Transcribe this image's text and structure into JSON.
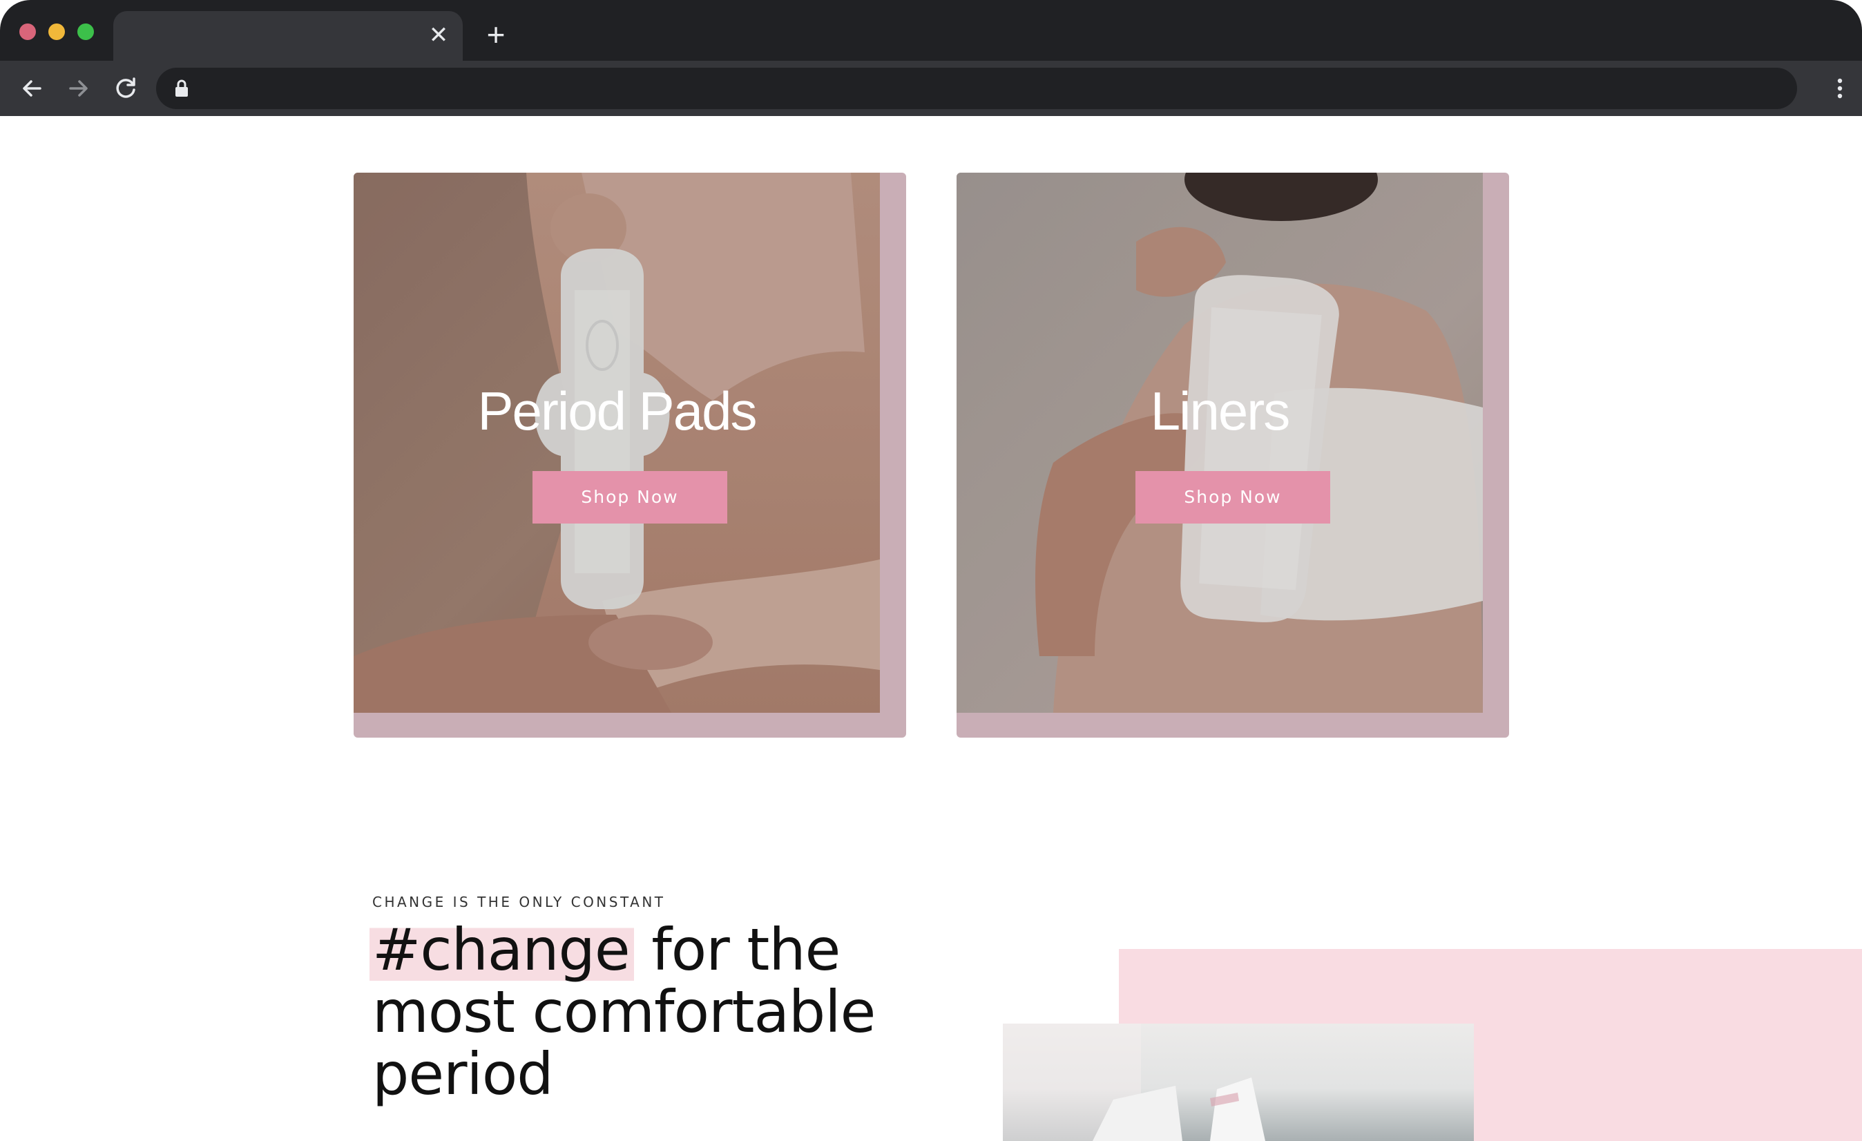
{
  "browser": {
    "tab_close_glyph": "✕",
    "new_tab_glyph": "+",
    "icons": [
      "back-arrow-icon",
      "forward-arrow-icon",
      "reload-icon",
      "lock-icon",
      "kebab-menu-icon"
    ]
  },
  "categories": [
    {
      "title": "Period Pads",
      "button_label": "Shop Now"
    },
    {
      "title": "Liners",
      "button_label": "Shop Now"
    }
  ],
  "promo": {
    "kicker": "CHANGE IS THE ONLY CONSTANT",
    "headline_highlight": "#change",
    "headline_line1_rest": " for the",
    "headline_line2": "most comfortable",
    "headline_line3": "period"
  },
  "colors": {
    "card_frame": "#c9aeb6",
    "button": "#e492aa",
    "highlight": "#f7dde2",
    "pink_block": "#f9dce2"
  }
}
